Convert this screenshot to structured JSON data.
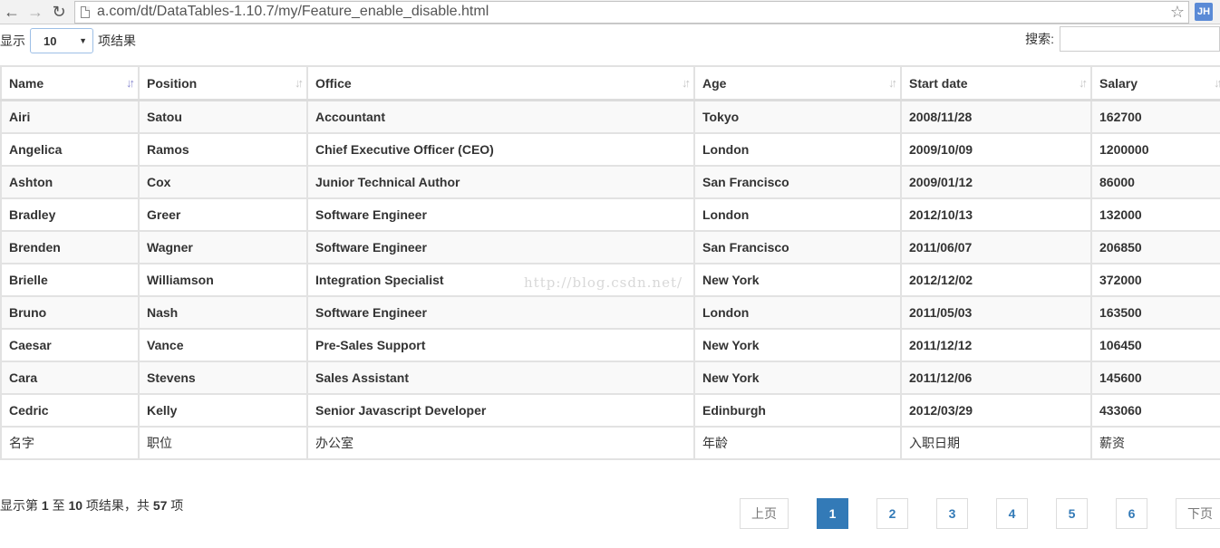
{
  "browser": {
    "url": "a.com/dt/DataTables-1.10.7/my/Feature_enable_disable.html",
    "extension_label": "JH"
  },
  "controls": {
    "length_prefix": "显示",
    "length_value": "10",
    "length_suffix": "项结果",
    "search_label": "搜索:",
    "search_value": ""
  },
  "table": {
    "columns": [
      "Name",
      "Position",
      "Office",
      "Age",
      "Start date",
      "Salary"
    ],
    "rows": [
      [
        "Airi",
        "Satou",
        "Accountant",
        "Tokyo",
        "2008/11/28",
        "162700"
      ],
      [
        "Angelica",
        "Ramos",
        "Chief Executive Officer (CEO)",
        "London",
        "2009/10/09",
        "1200000"
      ],
      [
        "Ashton",
        "Cox",
        "Junior Technical Author",
        "San Francisco",
        "2009/01/12",
        "86000"
      ],
      [
        "Bradley",
        "Greer",
        "Software Engineer",
        "London",
        "2012/10/13",
        "132000"
      ],
      [
        "Brenden",
        "Wagner",
        "Software Engineer",
        "San Francisco",
        "2011/06/07",
        "206850"
      ],
      [
        "Brielle",
        "Williamson",
        "Integration Specialist",
        "New York",
        "2012/12/02",
        "372000"
      ],
      [
        "Bruno",
        "Nash",
        "Software Engineer",
        "London",
        "2011/05/03",
        "163500"
      ],
      [
        "Caesar",
        "Vance",
        "Pre-Sales Support",
        "New York",
        "2011/12/12",
        "106450"
      ],
      [
        "Cara",
        "Stevens",
        "Sales Assistant",
        "New York",
        "2011/12/06",
        "145600"
      ],
      [
        "Cedric",
        "Kelly",
        "Senior Javascript Developer",
        "Edinburgh",
        "2012/03/29",
        "433060"
      ]
    ],
    "footer": [
      "名字",
      "职位",
      "办公室",
      "年龄",
      "入职日期",
      "薪资"
    ]
  },
  "watermark": "http://blog.csdn.net/",
  "info": {
    "p1": "显示第 ",
    "start": "1",
    "p2": " 至 ",
    "end": "10",
    "p3": " 项结果，共 ",
    "total": "57",
    "p4": " 项"
  },
  "pagination": {
    "prev": "上页",
    "pages": [
      "1",
      "2",
      "3",
      "4",
      "5",
      "6"
    ],
    "next": "下页"
  }
}
